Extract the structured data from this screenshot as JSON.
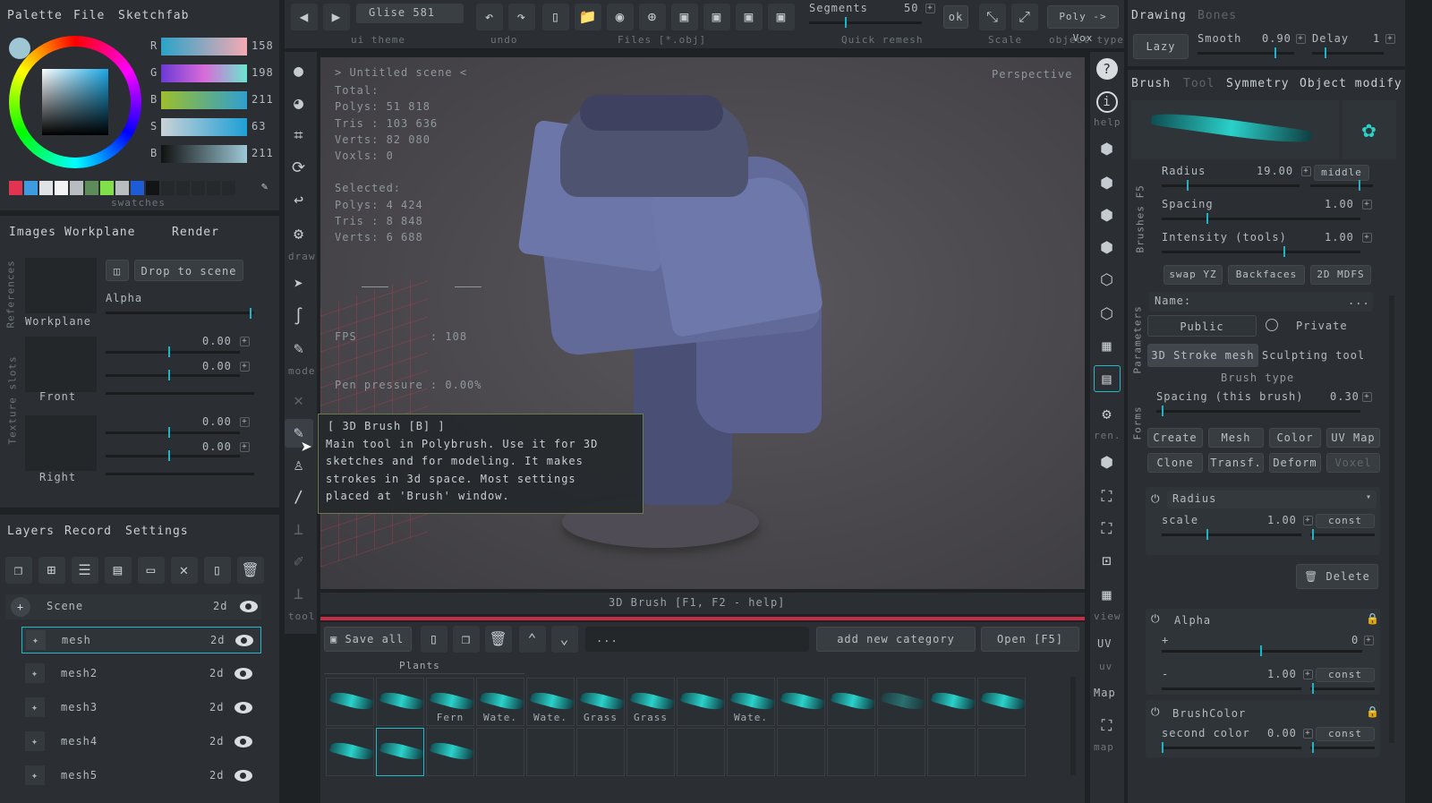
{
  "left_top": {
    "tabs": [
      "Palette",
      "File",
      "Sketchfab"
    ],
    "swatches_label": "swatches",
    "channels": [
      {
        "k": "R",
        "v": "158"
      },
      {
        "k": "G",
        "v": "198"
      },
      {
        "k": "B",
        "v": "211"
      },
      {
        "k": "S",
        "v": "63"
      },
      {
        "k": "B",
        "v": "211"
      }
    ]
  },
  "images": {
    "tabs": [
      "Images",
      "Workplane",
      "Render"
    ],
    "side1": "References",
    "side2": "Texture slots",
    "drop": "Drop to scene",
    "alpha": "Alpha",
    "workplane": "Workplane",
    "front": "Front",
    "right": "Right",
    "v1": "0.00",
    "v2": "0.00",
    "v3": "0.00",
    "v4": "0.00"
  },
  "layers": {
    "tabs": [
      "Layers",
      "Record",
      "Settings"
    ],
    "scene": "Scene",
    "tag": "2d",
    "items": [
      "mesh",
      "mesh2",
      "mesh3",
      "mesh4",
      "mesh5"
    ]
  },
  "top": {
    "glise": "Glise 581",
    "ui_theme": "ui theme",
    "undo": "undo",
    "files": "Files [*.obj]",
    "segments": "Segments",
    "seg_val": "50",
    "ok": "ok",
    "quick_remesh": "Quick remesh",
    "scale": "Scale",
    "poly_vox": "Poly -> Vox",
    "object_type": "object type"
  },
  "tools": {
    "draw": "draw",
    "mode": "mode",
    "tool": "tool"
  },
  "viewport": {
    "scene": "> Untitled scene <",
    "perspective": "Perspective",
    "total": "Total:",
    "polys": "Polys: 51 818",
    "tris": "Tris : 103 636",
    "verts": "Verts: 82 080",
    "voxls": "Voxls: 0",
    "selected": "Selected:",
    "spolys": "Polys: 4 424",
    "stris": "Tris : 8 848",
    "sverts": "Verts: 6 688",
    "fps": "FPS          : 108",
    "pen": "Pen pressure : 0.00%",
    "status": "3D Brush  [F1, F2 - help]"
  },
  "tooltip": {
    "title": "[ 3D Brush [B] ]",
    "l1": "Main tool in Polybrush. Use it for 3D",
    "l2": "sketches and for modeling. It makes",
    "l3": "strokes in 3d space. Most settings",
    "l4": "placed at 'Brush' window."
  },
  "bottom": {
    "save_all": "Save all",
    "dots": "...",
    "add_cat": "add new category",
    "open": "Open [F5]",
    "category": "Plants",
    "thumbs": [
      "",
      "",
      "Fern",
      "Wate.",
      "Wate.",
      "Grass",
      "Grass",
      "",
      "Wate.",
      "",
      "",
      "",
      "",
      ""
    ]
  },
  "right_tools": {
    "help": "help",
    "ren": "ren.",
    "view": "view",
    "uv": "UV",
    "uv2": "uv",
    "map": "Map",
    "map2": "map"
  },
  "drawing": {
    "tabs": [
      "Drawing",
      "Bones"
    ],
    "lazy": "Lazy",
    "smooth": "Smooth",
    "smooth_v": "0.90",
    "delay": "Delay",
    "delay_v": "1",
    "tabs2": [
      "Brush",
      "Tool",
      "Symmetry",
      "Object modify"
    ],
    "side_brushes": "Brushes F5",
    "radius": "Radius",
    "radius_v": "19.00",
    "middle": "middle",
    "spacing": "Spacing",
    "spacing_v": "1.00",
    "intensity": "Intensity (tools)",
    "intensity_v": "1.00",
    "swap": "swap YZ",
    "backfaces": "Backfaces",
    "mdfs": "2D MDFS",
    "side_params": "Parameters",
    "side_forms": "Forms",
    "name": "Name:",
    "name_dots": "...",
    "public": "Public",
    "private": "Private",
    "stroke_mesh": "3D Stroke mesh",
    "sculpt": "Sculpting tool",
    "brush_type": "Brush type",
    "spacing_this": "Spacing (this brush)",
    "spacing_this_v": "0.30",
    "b1": [
      "Create",
      "Mesh",
      "Color",
      "UV Map"
    ],
    "b2": [
      "Clone",
      "Transf.",
      "Deform",
      "Voxel"
    ],
    "radius2": "Radius",
    "scale": "scale",
    "scale_v": "1.00",
    "const": "const",
    "delete": "Delete",
    "alpha": "Alpha",
    "alpha_v": "0",
    "alpha2_v": "1.00",
    "brush_color": "BrushColor",
    "second_color": "second color",
    "second_v": "0.00"
  }
}
